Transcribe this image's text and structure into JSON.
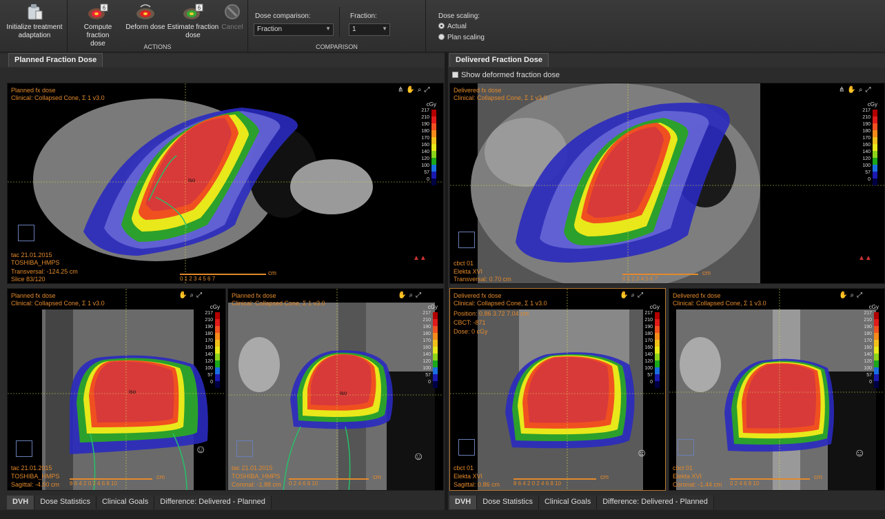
{
  "toolbar": {
    "init_label_1": "Initialize treatment",
    "init_label_2": "adaptation",
    "compute_label_1": "Compute fraction",
    "compute_label_2": "dose",
    "deform_label": "Deform dose",
    "estimate_label_1": "Estimate fraction",
    "estimate_label_2": "dose",
    "cancel_label": "Cancel",
    "badge": "6",
    "actions_title": "ACTIONS",
    "comparison_title": "COMPARISON",
    "dose_comparison_label": "Dose comparison:",
    "dose_comparison_value": "Fraction",
    "fraction_label": "Fraction:",
    "fraction_value": "1",
    "dose_scaling_label": "Dose scaling:",
    "scaling_actual": "Actual",
    "scaling_plan": "Plan scaling"
  },
  "left_panel": {
    "tab": "Planned Fraction Dose"
  },
  "right_panel": {
    "tab": "Delivered Fraction Dose",
    "checkbox_label": "Show deformed fraction dose"
  },
  "legend": {
    "unit": "cGy",
    "ticks": [
      "217",
      "210",
      "190",
      "180",
      "170",
      "160",
      "140",
      "120",
      "100",
      "57",
      "0"
    ],
    "colors": [
      "#b30000",
      "#e01a1a",
      "#f05020",
      "#f58a1a",
      "#f0c01a",
      "#e8e81a",
      "#8cd41a",
      "#1aa81a",
      "#1a6ee0",
      "#1a1ab0",
      "#000044"
    ]
  },
  "viewports": {
    "vp1": {
      "l1": "Planned fx dose",
      "l2": "Clinical: Collapsed Cone, Σ 1 v3.0",
      "b1": "tac 21.01.2015",
      "b2": "TOSHIBA_HMPS",
      "b3": "Transversal: -124.25 cm",
      "b4": "Slice 83/120",
      "iso": "iso",
      "scale_nums": "0  1  2  3  4  5  6  7",
      "scale_unit": "cm"
    },
    "vp2": {
      "l1": "Delivered fx dose",
      "l2": "Clinical: Collapsed Cone, Σ 1 v3.0",
      "b1": "cbct 01",
      "b2": "Elekta XVI",
      "b3": "Transversal: 0.70 cm",
      "scale_nums": "0  1  2  3  4  5  6  7",
      "scale_unit": "cm"
    },
    "vp3": {
      "l1": "Planned fx dose",
      "l2": "Clinical: Collapsed Cone, Σ 1 v3.0",
      "b1": "tac 21.01.2015",
      "b2": "TOSHIBA_HMPS",
      "b3": "Sagittal: -4.00 cm",
      "iso": "iso",
      "scale_nums": "8   6   4   2   0   2   4   6   8  10",
      "scale_unit": "cm"
    },
    "vp4": {
      "l1": "Planned fx dose",
      "l2": "Clinical: Collapsed Cone, Σ 1 v3.0",
      "b1": "tac 21.01.2015",
      "b2": "TOSHIBA_HMPS",
      "b3": "Coronal: -1.88 cm",
      "iso": "iso",
      "scale_nums": "0    2    4    6    8   10",
      "scale_unit": "cm"
    },
    "vp5": {
      "l1": "Delivered fx dose",
      "l2": "Clinical: Collapsed Cone, Σ 1 v3.0",
      "l3": "Position: 0.86 3.72 7.04 cm",
      "l4": "CBCT: -871",
      "l5": "Dose: 0 cGy",
      "b1": "cbct 01",
      "b2": "Elekta XVI",
      "b3": "Sagittal: 0.86 cm",
      "scale_nums": "8   6   4   2   0   2   4   6   8  10",
      "scale_unit": "cm"
    },
    "vp6": {
      "l1": "Delivered fx dose",
      "l2": "Clinical: Collapsed Cone, Σ 1 v3.0",
      "b1": "cbct 01",
      "b2": "Elekta XVI",
      "b3": "Coronal: -1.44 cm",
      "scale_nums": "0    2    4    6    8   10",
      "scale_unit": "cm"
    }
  },
  "bottom_tabs": {
    "left": [
      "DVH",
      "Dose Statistics",
      "Clinical Goals",
      "Difference: Delivered - Planned"
    ],
    "right": [
      "DVH",
      "Dose Statistics",
      "Clinical Goals",
      "Difference: Delivered - Planned"
    ]
  }
}
